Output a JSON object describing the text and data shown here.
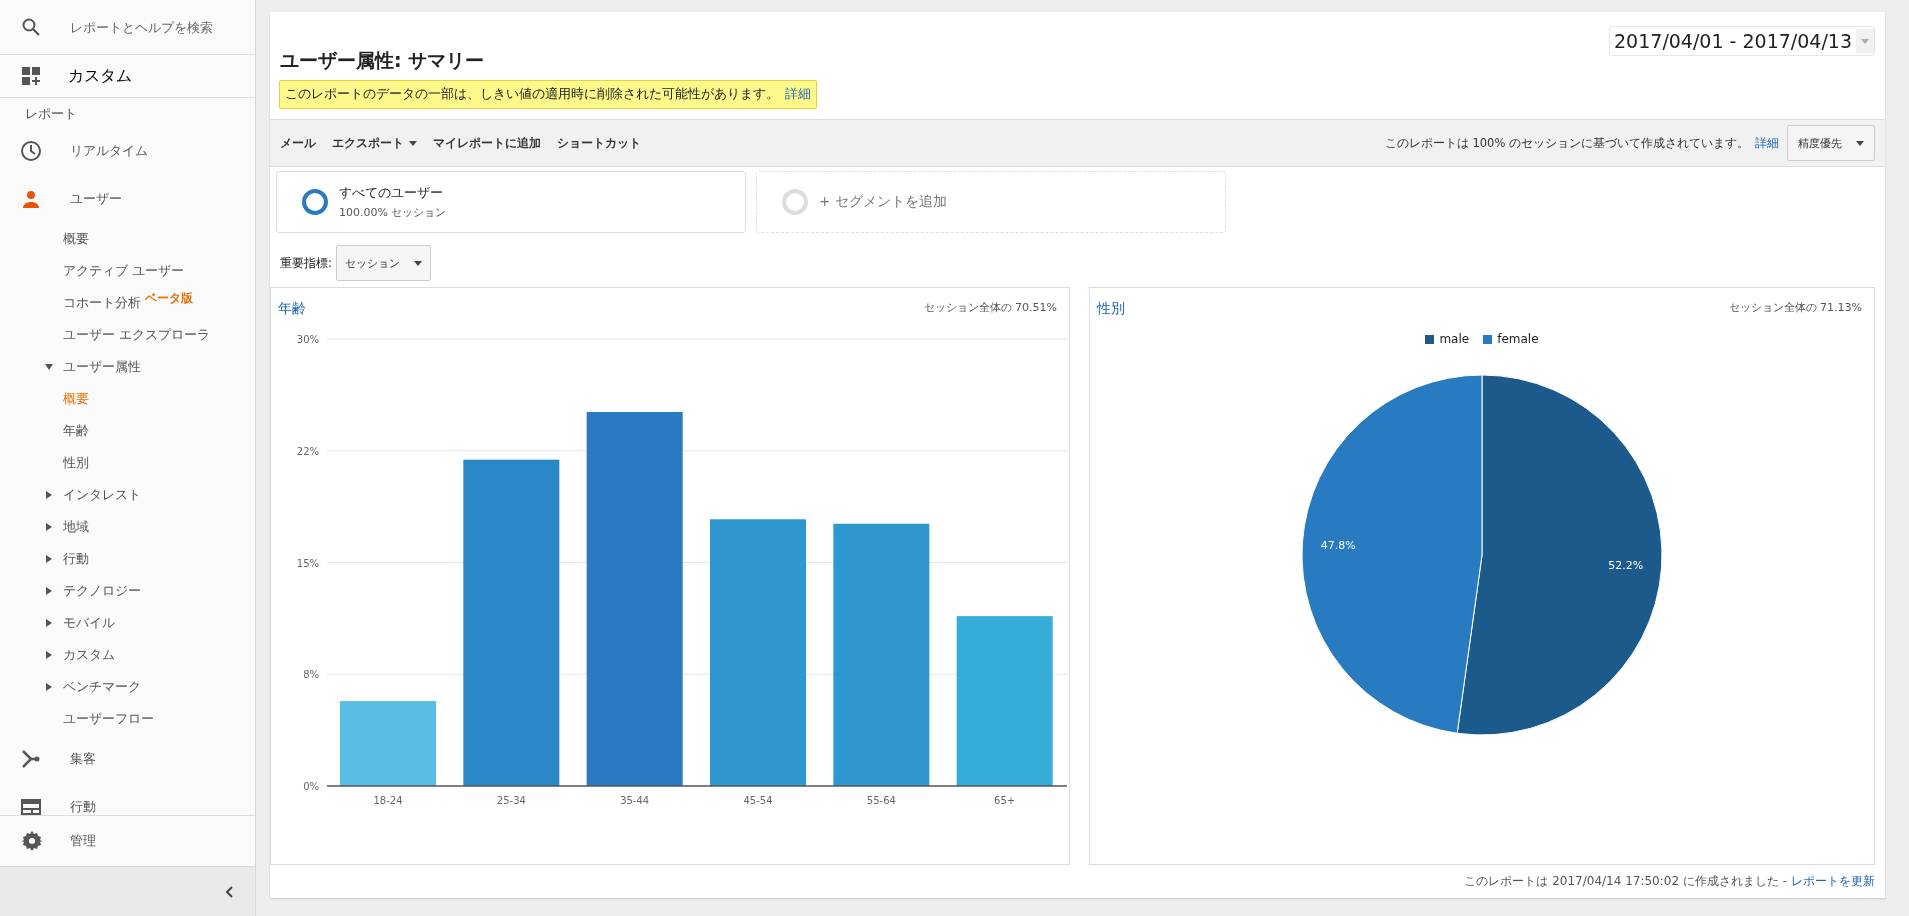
{
  "sidebar": {
    "search": {
      "placeholder": "レポートとヘルプを検索"
    },
    "custom": {
      "label": "カスタム"
    },
    "section_label": "レポート",
    "nav": [
      {
        "label": "リアルタイム",
        "selected": false
      },
      {
        "label": "ユーザー",
        "selected": true,
        "children": [
          {
            "label": "概要",
            "selected": false
          },
          {
            "label": "アクティブ ユーザー",
            "selected": false
          },
          {
            "label": "コホート分析",
            "badge": "ベータ版",
            "selected": false
          },
          {
            "label": "ユーザー エクスプローラ",
            "selected": false
          },
          {
            "label": "ユーザー属性",
            "selected": false,
            "expanded": true,
            "children": [
              {
                "label": "概要",
                "selected": true
              },
              {
                "label": "年齢",
                "selected": false
              },
              {
                "label": "性別",
                "selected": false
              }
            ]
          },
          {
            "label": "インタレスト",
            "selected": false,
            "expanded": false
          },
          {
            "label": "地域",
            "selected": false,
            "expanded": false
          },
          {
            "label": "行動",
            "selected": false,
            "expanded": false
          },
          {
            "label": "テクノロジー",
            "selected": false,
            "expanded": false
          },
          {
            "label": "モバイル",
            "selected": false,
            "expanded": false
          },
          {
            "label": "カスタム",
            "selected": false,
            "expanded": false
          },
          {
            "label": "ベンチマーク",
            "selected": false,
            "expanded": false
          },
          {
            "label": "ユーザーフロー",
            "selected": false
          }
        ]
      },
      {
        "label": "集客",
        "selected": false
      },
      {
        "label": "行動",
        "selected": false
      }
    ],
    "admin": {
      "label": "管理"
    }
  },
  "report": {
    "title": "ユーザー属性: サマリー",
    "date_range": "2017/04/01 - 2017/04/13",
    "notice": {
      "text": "このレポートのデータの一部は、しきい値の適用時に削除された可能性があります。",
      "link": "詳細"
    }
  },
  "toolbar": {
    "actions": [
      {
        "label": "メール",
        "dropdown": false
      },
      {
        "label": "エクスポート",
        "dropdown": true
      },
      {
        "label": "マイレポートに追加",
        "dropdown": false
      },
      {
        "label": "ショートカット",
        "dropdown": false
      }
    ],
    "sampling_text": "このレポートは 100% のセッションに基づいて作成されています。",
    "sampling_link": "詳細",
    "precision": "精度優先"
  },
  "segments": [
    {
      "kind": "active",
      "name": "すべてのユーザー",
      "detail": "100.00% セッション"
    },
    {
      "kind": "add",
      "name": "+ セグメントを追加"
    }
  ],
  "metric": {
    "label": "重要指標:",
    "value": "セッション"
  },
  "age_panel": {
    "coverage": "セッション全体の 70.51%",
    "chart_data": {
      "type": "bar",
      "title": "年齢",
      "categories": [
        "18-24",
        "25-34",
        "35-44",
        "45-54",
        "55-64",
        "65+"
      ],
      "series": [
        {
          "values": [
            5.7,
            21.9,
            25.1,
            17.9,
            17.6,
            11.4
          ],
          "colors": [
            "#59bee5",
            "#2b88c8",
            "#2a7ac1",
            "#2e97cf",
            "#2e97cf",
            "#36acd9"
          ]
        }
      ],
      "grid": true,
      "ylim": [
        0,
        30
      ],
      "yticks": [
        {
          "value": 0,
          "label": "0%"
        },
        {
          "value": 7.5,
          "label": "8%"
        },
        {
          "value": 15,
          "label": "15%"
        },
        {
          "value": 22.5,
          "label": "22%"
        },
        {
          "value": 30,
          "label": "30%"
        }
      ]
    }
  },
  "gender_panel": {
    "coverage": "セッション全体の 71.13%",
    "chart_data": {
      "type": "pie",
      "title": "性別",
      "categories": [
        "male",
        "female"
      ],
      "series": [
        {
          "values": [
            52.2,
            47.8
          ],
          "colors": [
            "#1c5a8c",
            "#287bc0"
          ]
        }
      ],
      "value_labels": [
        "52.2%",
        "47.8%"
      ],
      "legend": "top"
    }
  },
  "footer": {
    "text": "このレポートは 2017/04/14 17:50:02 に作成されました -",
    "link": "レポートを更新"
  }
}
